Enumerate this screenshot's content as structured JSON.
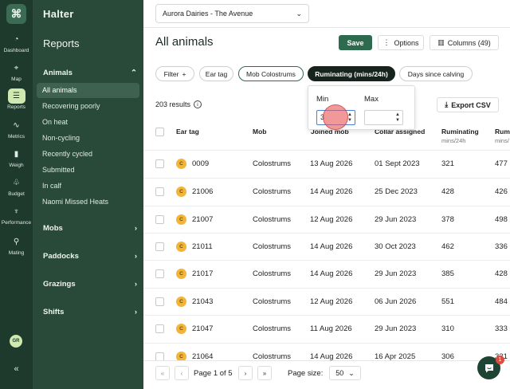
{
  "rail": {
    "items": [
      {
        "label": "Dashboard",
        "icon": "gauge-icon",
        "glyph": "◔"
      },
      {
        "label": "Map",
        "icon": "map-pin-icon",
        "glyph": "⌖"
      },
      {
        "label": "Reports",
        "icon": "list-icon",
        "glyph": "☰"
      },
      {
        "label": "Metrics",
        "icon": "line-chart-icon",
        "glyph": "∿"
      },
      {
        "label": "Weigh",
        "icon": "bar-chart-icon",
        "glyph": "▮"
      },
      {
        "label": "Budget",
        "icon": "sprout-icon",
        "glyph": "♧"
      },
      {
        "label": "Performance",
        "icon": "trophy-icon",
        "glyph": "♆"
      },
      {
        "label": "Mating",
        "icon": "search-heart-icon",
        "glyph": "⚲"
      }
    ],
    "avatar": "GR",
    "collapse": "«"
  },
  "sidebar": {
    "brand": "Halter",
    "title": "Reports",
    "animals_section": "Animals",
    "animals_items": [
      "All animals",
      "Recovering poorly",
      "On heat",
      "Non-cycling",
      "Recently cycled",
      "Submitted",
      "In calf",
      "Naomi Missed Heats"
    ],
    "sections": [
      "Mobs",
      "Paddocks",
      "Grazings",
      "Shifts"
    ]
  },
  "header": {
    "farm": "Aurora Dairies - The Avenue",
    "title": "All animals",
    "save": "Save",
    "options": "Options",
    "columns": "Columns (49)"
  },
  "filters": {
    "filter": "Filter",
    "chips": [
      "Ear tag",
      "Mob Colostrums",
      "Ruminating (mins/24h)",
      "Days since calving"
    ]
  },
  "results": "203 results",
  "export": "Export CSV",
  "popover": {
    "min_label": "Min",
    "max_label": "Max",
    "min_value": "3",
    "max_value": ""
  },
  "table": {
    "headers": {
      "ear_tag": "Ear tag",
      "mob": "Mob",
      "joined": "Joined mob",
      "collar": "Collar assigned",
      "ruminating": "Ruminating",
      "ruminating_sub": "mins/24h",
      "rum2": "Rum",
      "rum2_sub": "mins/"
    },
    "rows": [
      {
        "badge": "C",
        "ear_tag": "0009",
        "mob": "Colostrums",
        "joined": "13 Aug 2026",
        "collar": "01 Sept 2023",
        "ruminating": "321",
        "rum2": "477"
      },
      {
        "badge": "C",
        "ear_tag": "21006",
        "mob": "Colostrums",
        "joined": "14 Aug 2026",
        "collar": "25 Dec 2023",
        "ruminating": "428",
        "rum2": "426"
      },
      {
        "badge": "C",
        "ear_tag": "21007",
        "mob": "Colostrums",
        "joined": "12 Aug 2026",
        "collar": "29 Jun 2023",
        "ruminating": "378",
        "rum2": "498"
      },
      {
        "badge": "C",
        "ear_tag": "21011",
        "mob": "Colostrums",
        "joined": "14 Aug 2026",
        "collar": "30 Oct 2023",
        "ruminating": "462",
        "rum2": "336"
      },
      {
        "badge": "C",
        "ear_tag": "21017",
        "mob": "Colostrums",
        "joined": "14 Aug 2026",
        "collar": "29 Jun 2023",
        "ruminating": "385",
        "rum2": "428"
      },
      {
        "badge": "C",
        "ear_tag": "21043",
        "mob": "Colostrums",
        "joined": "12 Aug 2026",
        "collar": "06 Jun 2026",
        "ruminating": "551",
        "rum2": "484"
      },
      {
        "badge": "C",
        "ear_tag": "21047",
        "mob": "Colostrums",
        "joined": "11 Aug 2026",
        "collar": "29 Jun 2023",
        "ruminating": "310",
        "rum2": "333"
      },
      {
        "badge": "C",
        "ear_tag": "21064",
        "mob": "Colostrums",
        "joined": "14 Aug 2026",
        "collar": "16 Apr 2025",
        "ruminating": "306",
        "rum2": "331"
      }
    ]
  },
  "pagination": {
    "first": "«",
    "prev": "‹",
    "page_text": "Page 1 of 5",
    "next": "›",
    "last": "»",
    "page_size_label": "Page size:",
    "page_size": "50"
  },
  "chat": {
    "badge": "1"
  },
  "colors": {
    "accent": "#2e6b4e",
    "rail": "#1d3a2c",
    "sidebar": "#2a4a39",
    "badge": "#f2b53a"
  }
}
